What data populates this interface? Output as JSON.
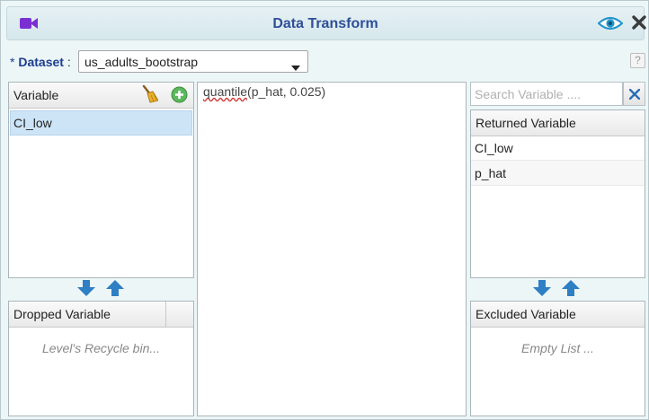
{
  "window": {
    "title": "Data Transform",
    "colors": {
      "title": "#2f4f98",
      "accent_icon": "#7b2fd3",
      "eye_icon": "#2496c9",
      "selection": "#cde4f7"
    },
    "icons": {
      "left": "video-camera-icon",
      "preview": "eye-icon",
      "close": "close-icon"
    }
  },
  "dataset": {
    "required_mark": "*",
    "label": "Dataset",
    "separator": ":",
    "selected": "us_adults_bootstrap",
    "help": "?"
  },
  "variables": {
    "header": "Variable",
    "items": [
      "CI_low"
    ],
    "icons": {
      "clear": "broom-icon",
      "add": "plus-circle-icon"
    }
  },
  "dropped": {
    "header": "Dropped Variable",
    "empty_text": "Level's Recycle bin..."
  },
  "editor": {
    "function_name": "quantile",
    "arguments": "(p_hat, 0.025)"
  },
  "search": {
    "placeholder": "Search Variable ...."
  },
  "returned": {
    "header": "Returned Variable",
    "items": [
      "CI_low",
      "p_hat"
    ]
  },
  "excluded": {
    "header": "Excluded Variable",
    "empty_text": "Empty List ..."
  }
}
